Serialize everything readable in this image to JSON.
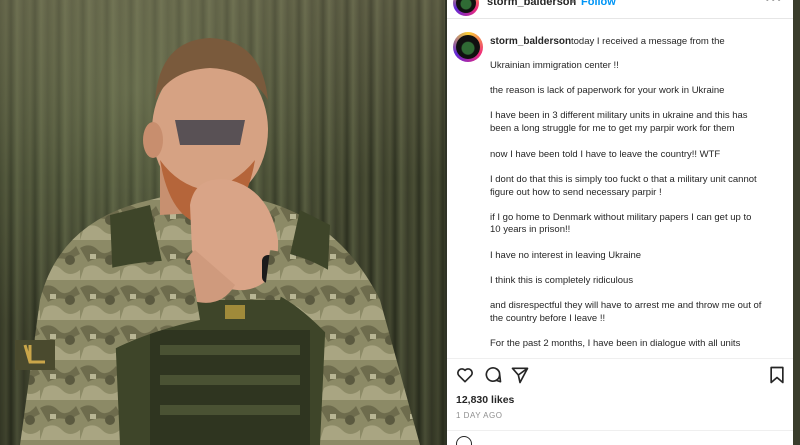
{
  "header": {
    "username": "storm_balderson",
    "dot": "•",
    "follow_label": "Follow",
    "more": "•••"
  },
  "caption": {
    "username": "storm_balderson",
    "lines": [
      "today I received a message from the",
      "Ukrainian immigration center !!",
      "the reason is lack of paperwork for your work in Ukraine",
      "I have been in 3 different military units in ukraine and this has",
      "been a long struggle for me to get my parpir work for them",
      "now I have been told I have to leave the country!! WTF",
      "I dont do that this is simply too fuckt o that a military unit cannot",
      "figure out how to send necessary parpir !",
      "if I go home to Denmark without military papers I can get up to",
      "10 years in prison!!",
      "I have no interest in leaving Ukraine",
      "I think this is completely ridiculous",
      "and disrespectful they will have to arrest me and throw me out of",
      "the country before I leave !!",
      "For the past 2 months, I have been in dialogue with all units"
    ]
  },
  "actions": {
    "like_icon": "heart-icon",
    "comment_icon": "comment-icon",
    "share_icon": "paper-plane-icon",
    "save_icon": "bookmark-icon"
  },
  "likes": "12,830 likes",
  "time_ago": "1 DAY AGO",
  "colors": {
    "link": "#0095f6",
    "text": "#262626",
    "muted": "#8e8e8e"
  }
}
